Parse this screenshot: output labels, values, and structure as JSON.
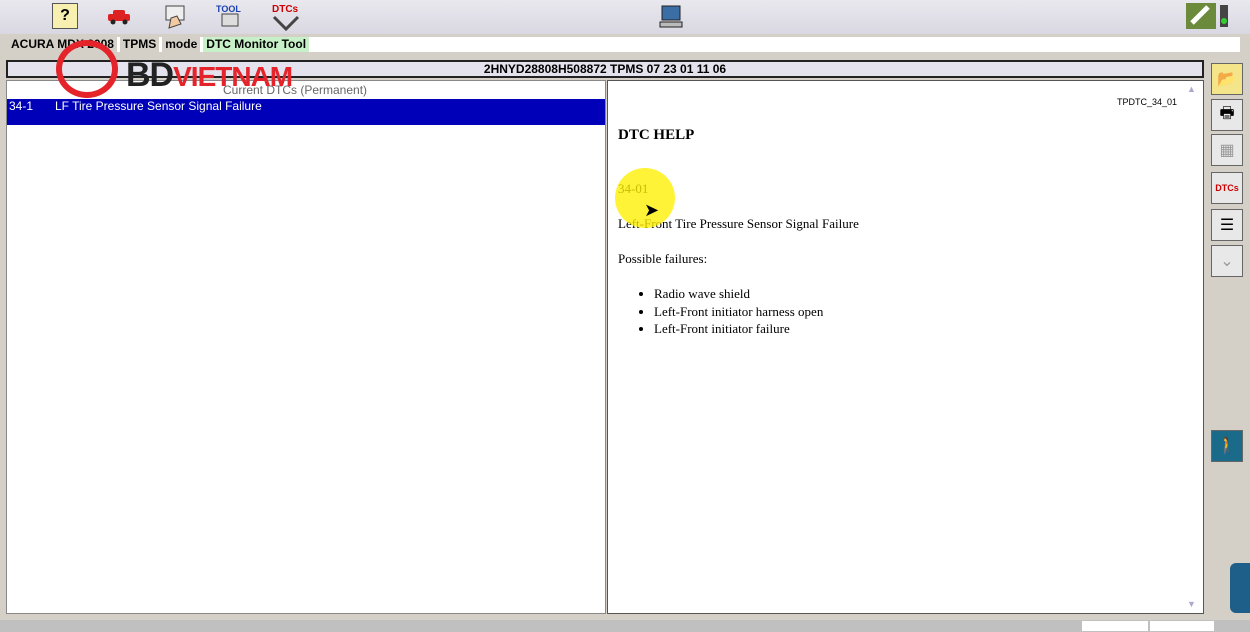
{
  "toolbar": {
    "help_label": "?",
    "dtcs_label": "DTCs",
    "tool_label": "TOOL"
  },
  "breadcrumb": {
    "vehicle": "ACURA MDX 2008",
    "system": "TPMS",
    "mode": "mode",
    "tool": "DTC Monitor Tool"
  },
  "title_bar": {
    "text": "2HNYD28808H508872  TPMS  07 23 01 11 06"
  },
  "dtc_list": {
    "header": "Current DTCs (Permanent)",
    "rows": [
      {
        "code": "34-1",
        "description": "LF Tire Pressure Sensor Signal Failure"
      }
    ]
  },
  "help": {
    "doc_id": "TPDTC_34_01",
    "title": "DTC HELP",
    "code": "34-01",
    "description": "Left-Front Tire Pressure Sensor Signal Failure",
    "failures_heading": "Possible failures:",
    "failures": [
      "Radio wave shield",
      "Left-Front initiator harness open",
      "Left-Front initiator failure"
    ]
  },
  "side_toolbar": {
    "dtc_label": "DTCs"
  },
  "watermark": {
    "brand_a": "BD",
    "brand_b": "VIETNAM"
  },
  "colors": {
    "selection": "#0000b8",
    "brand_red": "#e4232a"
  }
}
